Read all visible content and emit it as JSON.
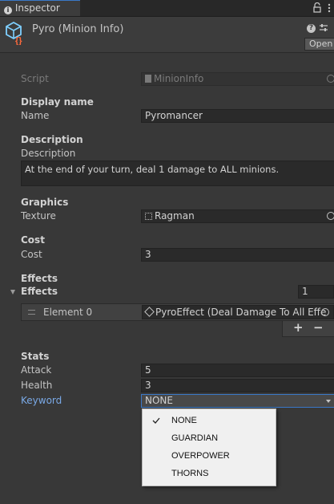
{
  "tab": {
    "icon": "info-icon",
    "label": "Inspector",
    "lock_icon": "lock-icon",
    "menu_icon": "kebab-menu-icon"
  },
  "header": {
    "title": "Pyro (Minion Info)",
    "asset_icon": "scriptable-object-icon",
    "help_icon": "help-icon",
    "settings_icon": "settings-icon",
    "open_label": "Open"
  },
  "script": {
    "label": "Script",
    "value": "MinionInfo",
    "icon": "script-file-icon",
    "picker_icon": "object-picker-icon"
  },
  "display_name": {
    "header": "Display name",
    "label": "Name",
    "value": "Pyromancer"
  },
  "description": {
    "header": "Description",
    "label": "Description",
    "value": "At the end of your turn, deal 1 damage to ALL minions."
  },
  "graphics": {
    "header": "Graphics",
    "label": "Texture",
    "value": "Ragman",
    "icon": "texture-icon",
    "picker_icon": "object-picker-icon"
  },
  "cost": {
    "header": "Cost",
    "label": "Cost",
    "value": "3"
  },
  "effects": {
    "header": "Effects",
    "foldout_label": "Effects",
    "foldout_icon": "triangle-down-icon",
    "size": "1",
    "element_label": "Element 0",
    "drag_icon": "drag-handle-icon",
    "element_value": "PyroEffect (Deal Damage To All Effe",
    "element_icon": "scriptable-object-icon",
    "picker_icon": "object-picker-icon",
    "add_label": "+",
    "remove_label": "−"
  },
  "stats": {
    "header": "Stats",
    "attack_label": "Attack",
    "attack_value": "5",
    "health_label": "Health",
    "health_value": "3",
    "keyword_label": "Keyword",
    "keyword_value": "NONE",
    "keyword_arrow_icon": "dropdown-arrow-icon"
  },
  "keyword_dropdown": {
    "check_icon": "checkmark-icon",
    "options": [
      "NONE",
      "GUARDIAN",
      "OVERPOWER",
      "THORNS"
    ],
    "selected": "NONE"
  },
  "colors": {
    "background": "#383838",
    "field": "#2a2a2a",
    "accent": "#3a78c7",
    "link_label": "#7aa9e6",
    "icon_orange": "#ff6a3c",
    "icon_cyan": "#7fd0ff"
  }
}
